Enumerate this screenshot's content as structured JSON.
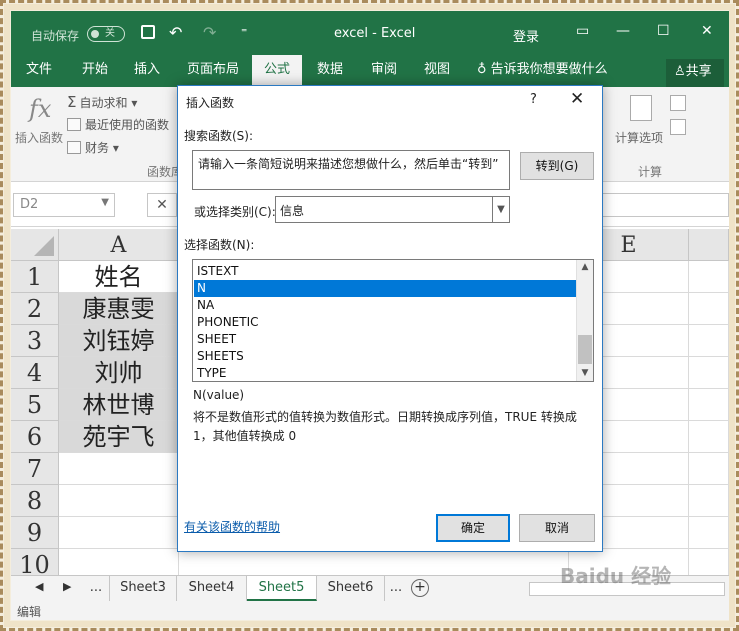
{
  "titlebar": {
    "autosave_label": "自动保存",
    "autosave_state": "关",
    "undo_icon": "↶",
    "redo_icon": "↷",
    "more_icon": "⁼",
    "title": "excel  -  Excel",
    "login": "登录"
  },
  "ribbon_tabs": [
    "文件",
    "开始",
    "插入",
    "页面布局",
    "公式",
    "数据",
    "审阅",
    "视图"
  ],
  "ribbon_active_tab": "公式",
  "tell_me": "告诉我你想要做什么",
  "share": "共享",
  "ribbon": {
    "insert_function": "插入函数",
    "autosum": "自动求和",
    "recent": "最近使用的函数",
    "finance": "财务",
    "group_label_left": "函数库",
    "calc_options": "计算选项",
    "group_label_right": "计算"
  },
  "formula_bar": {
    "name_box": "D2"
  },
  "grid": {
    "columns": [
      "A",
      "E"
    ],
    "rows": [
      "1",
      "2",
      "3",
      "4",
      "5",
      "6",
      "7",
      "8",
      "9",
      "10"
    ],
    "col_a_values": [
      "姓名",
      "康惠雯",
      "刘钰婷",
      "刘帅",
      "林世博",
      "苑宇飞"
    ]
  },
  "sheets": {
    "more": "...",
    "tabs": [
      "Sheet3",
      "Sheet4",
      "Sheet5",
      "Sheet6"
    ],
    "active": "Sheet5",
    "more_right": "...",
    "add": "+"
  },
  "statusbar": "编辑",
  "dialog": {
    "title": "插入函数",
    "help": "?",
    "search_label": "搜索函数(S):",
    "search_value": "请输入一条简短说明来描述您想做什么，然后单击“转到”",
    "go_button": "转到(G)",
    "category_label": "或选择类别(C):",
    "category_value": "信息",
    "list_label": "选择函数(N):",
    "functions": [
      "ISTEXT",
      "N",
      "NA",
      "PHONETIC",
      "SHEET",
      "SHEETS",
      "TYPE"
    ],
    "selected_function": "N",
    "signature": "N(value)",
    "description": "将不是数值形式的值转换为数值形式。日期转换成序列值，TRUE 转换成 1，其他值转换成 0",
    "help_link": "有关该函数的帮助",
    "ok": "确定",
    "cancel": "取消"
  },
  "watermark": "Baidu 经验",
  "colors": {
    "excel_green": "#217346",
    "selection_blue": "#0078d7",
    "link_blue": "#0b5cab"
  }
}
